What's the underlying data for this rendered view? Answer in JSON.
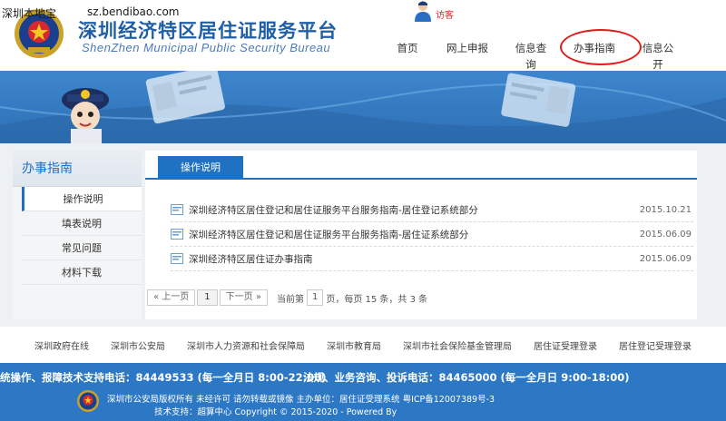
{
  "watermark": {
    "brand": "深圳本地宝",
    "url": "sz.bendibao.com"
  },
  "header": {
    "title": "深圳经济特区居住证服务平台",
    "subtitle": "ShenZhen Municipal Public Security Bureau",
    "user_name": "访客",
    "nav": [
      "首页",
      "网上申报",
      "信息查询",
      "办事指南",
      "信息公开"
    ],
    "highlighted_nav": "办事指南"
  },
  "sidebar": {
    "title": "办事指南",
    "items": [
      "操作说明",
      "填表说明",
      "常见问题",
      "材料下载"
    ],
    "active_index": 0
  },
  "content": {
    "tab": "操作说明",
    "items": [
      {
        "title": "深圳经济特区居住登记和居住证服务平台服务指南-居住登记系统部分",
        "date": "2015.10.21"
      },
      {
        "title": "深圳经济特区居住登记和居住证服务平台服务指南-居住证系统部分",
        "date": "2015.06.09"
      },
      {
        "title": "深圳经济特区居住证办事指南",
        "date": "2015.06.09"
      }
    ],
    "pager": {
      "prev": "« 上一页",
      "page": "1",
      "next": "下一页 »",
      "current_label": "当前第",
      "current_page": "1",
      "summary": "页，每页 15 条，共 3 条"
    }
  },
  "links": [
    "深圳政府在线",
    "深圳市公安局",
    "深圳市人力资源和社会保障局",
    "深圳市教育局",
    "深圳市社会保险基金管理局",
    "居住证受理登录",
    "居住登记受理登录"
  ],
  "footer": {
    "hotline_left": "统操作、报障技术支持电话：84449533 (每一全月日 8:00-22:00)",
    "hotline_right": "法规、业务咨询、投诉电话：84465000 (每一全月日 9:00-18:00)",
    "line1": "深圳市公安局版权所有 未经许可 请勿转载或镜像 主办单位：居住证受理系统 粤ICP备12007389号-3",
    "line2": "技术支持：超算中心       Copyright © 2015-2020 - Powered By"
  },
  "colors": {
    "brand_blue": "#1f72c2",
    "footer_blue": "#2c78c5",
    "title_blue": "#1f5fa8",
    "highlight_red": "#e21b1b"
  }
}
